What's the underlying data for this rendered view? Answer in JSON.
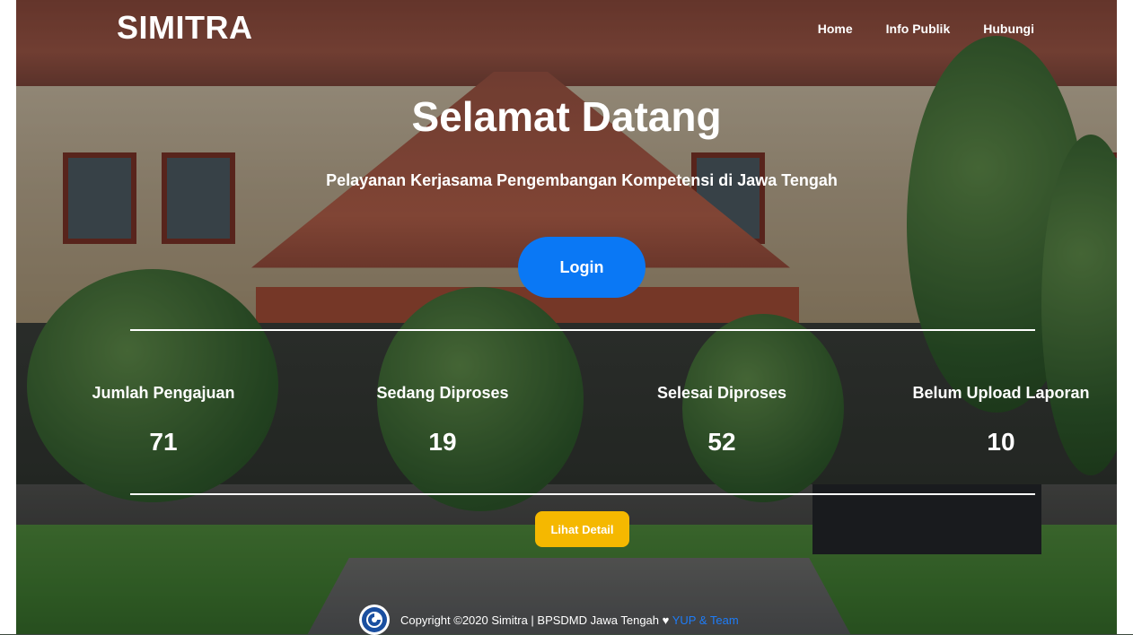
{
  "navbar": {
    "brand": "SIMITRA",
    "links": [
      {
        "label": "Home"
      },
      {
        "label": "Info Publik"
      },
      {
        "label": "Hubungi"
      }
    ]
  },
  "hero": {
    "title": "Selamat Datang",
    "subtitle": "Pelayanan Kerjasama Pengembangan Kompetensi di Jawa Tengah",
    "login_label": "Login"
  },
  "stats": [
    {
      "label": "Jumlah Pengajuan",
      "value": "71"
    },
    {
      "label": "Sedang Diproses",
      "value": "19"
    },
    {
      "label": "Selesai Diproses",
      "value": "52"
    },
    {
      "label": "Belum Upload Laporan",
      "value": "10"
    }
  ],
  "detail_button": "Lihat Detail",
  "footer": {
    "copyright": "Copyright ©2020 Simitra | BPSDMD Jawa Tengah ♥",
    "team_link": "YUP & Team"
  },
  "colors": {
    "primary": "#0a78f5",
    "warning": "#f5b800",
    "team_link": "#1e7cf7"
  }
}
